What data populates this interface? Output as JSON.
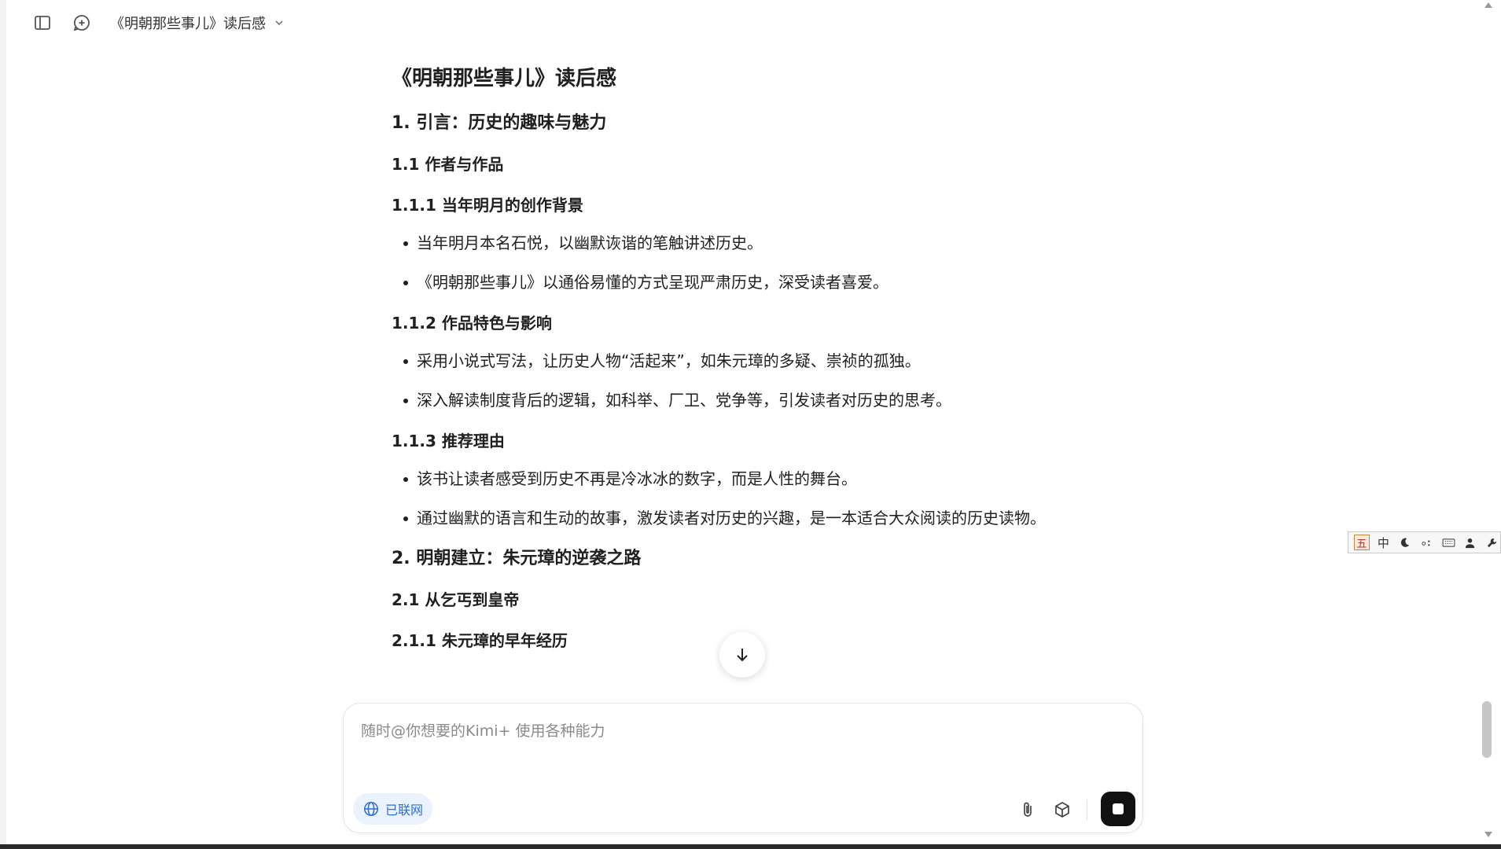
{
  "header": {
    "title": "《明朝那些事儿》读后感"
  },
  "document": {
    "title": "《明朝那些事儿》读后感",
    "s1": "1. 引言：历史的趣味与魅力",
    "s1_1": "1.1 作者与作品",
    "s1_1_1": "1.1.1 当年明月的创作背景",
    "s1_1_1_items": [
      "当年明月本名石悦，以幽默诙谐的笔触讲述历史。",
      "《明朝那些事儿》以通俗易懂的方式呈现严肃历史，深受读者喜爱。"
    ],
    "s1_1_2": "1.1.2 作品特色与影响",
    "s1_1_2_items": [
      "采用小说式写法，让历史人物“活起来”，如朱元璋的多疑、崇祯的孤独。",
      "深入解读制度背后的逻辑，如科举、厂卫、党争等，引发读者对历史的思考。"
    ],
    "s1_1_3": "1.1.3 推荐理由",
    "s1_1_3_items": [
      "该书让读者感受到历史不再是冷冰冰的数字，而是人性的舞台。",
      "通过幽默的语言和生动的故事，激发读者对历史的兴趣，是一本适合大众阅读的历史读物。"
    ],
    "s2": "2. 明朝建立：朱元璋的逆袭之路",
    "s2_1": "2.1 从乞丐到皇帝",
    "s2_1_1": "2.1.1 朱元璋的早年经历"
  },
  "input": {
    "placeholder": "随时@你想要的Kimi+ 使用各种能力",
    "network_label": "已联网"
  },
  "ime": {
    "wu": "五",
    "mode": "中"
  },
  "colors": {
    "accent_blue": "#2f6fd8",
    "pill_bg": "#eaf2fd",
    "send_bg": "#111111"
  },
  "icons": {
    "sidebar": "sidebar-toggle-icon",
    "new_chat": "new-chat-icon",
    "chevron": "chevron-down-icon",
    "scroll": "arrow-down-icon",
    "globe": "globe-icon",
    "attach": "paperclip-icon",
    "cube": "cube-icon",
    "stop": "stop-icon"
  }
}
